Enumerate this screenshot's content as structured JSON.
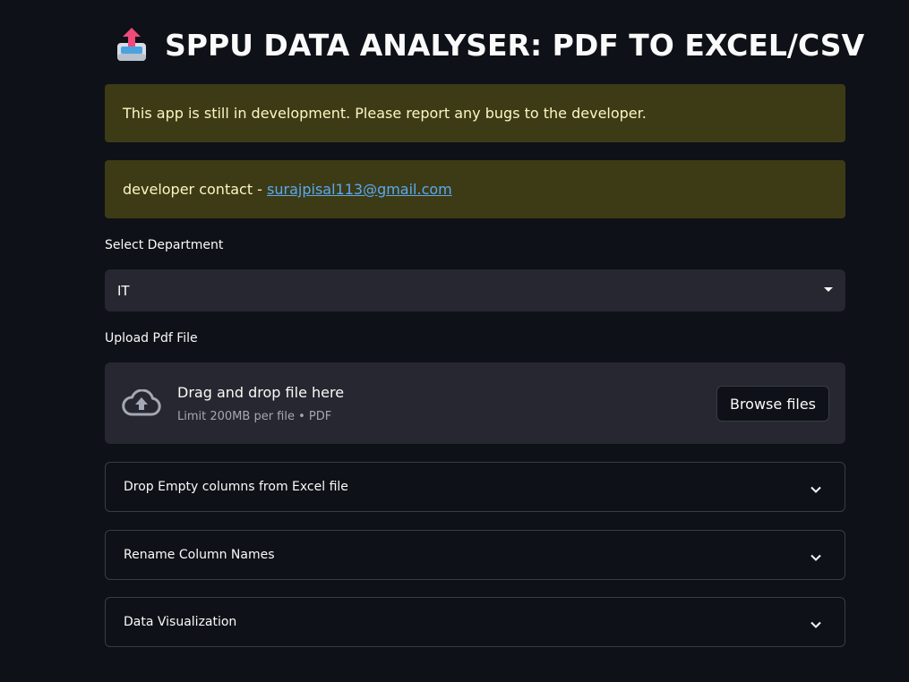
{
  "header": {
    "icon": "outbox-tray-icon",
    "title": "SPPU DATA ANALYSER: PDF TO EXCEL/CSV"
  },
  "alerts": {
    "dev_notice": "This app is still in development. Please report any bugs to the developer.",
    "contact_prefix": "developer contact - ",
    "contact_email": "surajpisal113@gmail.com"
  },
  "department": {
    "label": "Select Department",
    "selected": "IT"
  },
  "upload": {
    "label": "Upload Pdf File",
    "drop_title": "Drag and drop file here",
    "limit": "Limit 200MB per file • PDF",
    "browse_label": "Browse files"
  },
  "expanders": [
    {
      "label": "Drop Empty columns from Excel file"
    },
    {
      "label": "Rename Column Names"
    },
    {
      "label": "Data Visualization"
    }
  ],
  "colors": {
    "background": "#0e1117",
    "alert_bg": "#3d3b16",
    "alert_text": "#fcf6c0",
    "link": "#5aa9f0",
    "widget_bg": "#262730"
  }
}
